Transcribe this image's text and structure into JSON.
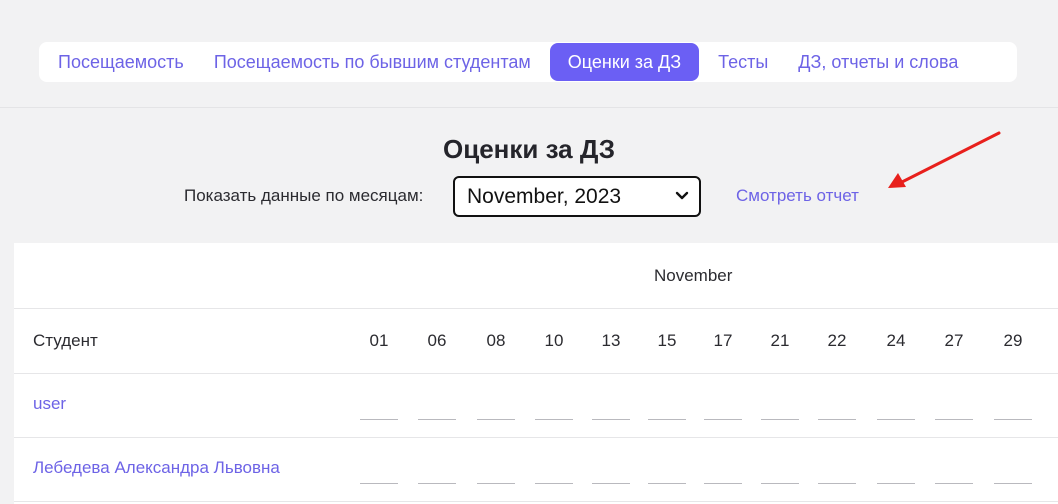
{
  "tabs": [
    {
      "label": "Посещаемость",
      "active": false
    },
    {
      "label": "Посещаемость по бывшим студентам",
      "active": false
    },
    {
      "label": "Оценки за ДЗ",
      "active": true
    },
    {
      "label": "Тесты",
      "active": false
    },
    {
      "label": "ДЗ, отчеты и слова",
      "active": false
    }
  ],
  "page_title": "Оценки за ДЗ",
  "filter": {
    "label": "Показать данные по месяцам:",
    "selected_month": "November, 2023"
  },
  "report_link": "Смотреть отчет",
  "annotation": {
    "arrow_color": "#e8201c"
  },
  "table": {
    "month": "November",
    "student_header": "Студент",
    "days": [
      "01",
      "06",
      "08",
      "10",
      "13",
      "15",
      "17",
      "21",
      "22",
      "24",
      "27",
      "29"
    ],
    "students": [
      {
        "name": "user",
        "grades": [
          "",
          "",
          "",
          "",
          "",
          "",
          "",
          "",
          "",
          "",
          "",
          ""
        ]
      },
      {
        "name": "Лебедева Александра Львовна",
        "grades": [
          "",
          "",
          "",
          "",
          "",
          "",
          "",
          "",
          "",
          "",
          "",
          ""
        ]
      }
    ]
  },
  "colors": {
    "accent": "#6b5ff4",
    "link": "#6d63e6"
  }
}
